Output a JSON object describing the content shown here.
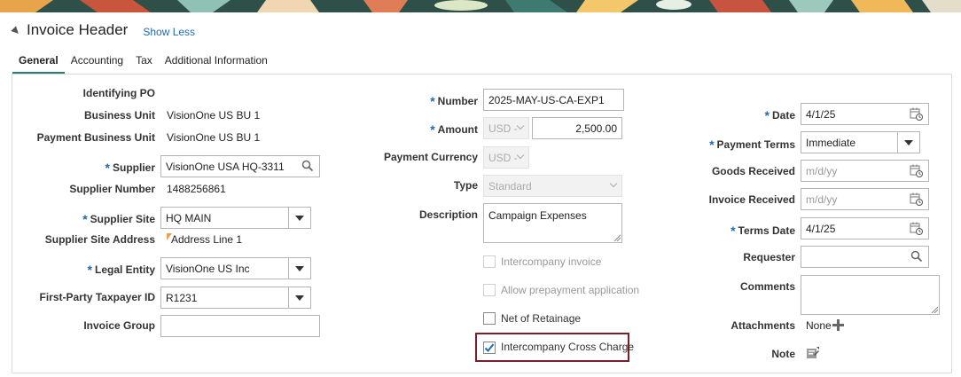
{
  "header": {
    "title": "Invoice Header",
    "show_less": "Show Less"
  },
  "tabs": [
    {
      "label": "General"
    },
    {
      "label": "Accounting"
    },
    {
      "label": "Tax"
    },
    {
      "label": "Additional Information"
    }
  ],
  "left": {
    "identifying_po_label": "Identifying PO",
    "business_unit_label": "Business Unit",
    "business_unit_value": "VisionOne US BU 1",
    "payment_bu_label": "Payment Business Unit",
    "payment_bu_value": "VisionOne US BU 1",
    "supplier_label": "Supplier",
    "supplier_value": "VisionOne USA HQ-3311",
    "supplier_number_label": "Supplier Number",
    "supplier_number_value": "1488256861",
    "supplier_site_label": "Supplier Site",
    "supplier_site_value": "HQ MAIN",
    "supplier_site_address_label": "Supplier Site Address",
    "supplier_site_address_value": "Address Line 1",
    "legal_entity_label": "Legal Entity",
    "legal_entity_value": "VisionOne US Inc",
    "taxpayer_label": "First-Party Taxpayer ID",
    "taxpayer_value": "R1231",
    "invoice_group_label": "Invoice Group",
    "invoice_group_value": ""
  },
  "middle": {
    "number_label": "Number",
    "number_value": "2025-MAY-US-CA-EXP1",
    "amount_label": "Amount",
    "amount_currency": "USD -",
    "amount_value": "2,500.00",
    "payment_currency_label": "Payment Currency",
    "payment_currency_value": "USD -",
    "type_label": "Type",
    "type_value": "Standard",
    "description_label": "Description",
    "description_value": "Campaign Expenses",
    "intercompany_invoice": "Intercompany invoice",
    "allow_prepayment": "Allow prepayment application",
    "net_of_retainage": "Net of Retainage",
    "intercompany_cross_charge": "Intercompany Cross Charge"
  },
  "right": {
    "date_label": "Date",
    "date_value": "4/1/25",
    "payment_terms_label": "Payment Terms",
    "payment_terms_value": "Immediate",
    "goods_received_label": "Goods Received",
    "goods_received_placeholder": "m/d/yy",
    "invoice_received_label": "Invoice Received",
    "invoice_received_placeholder": "m/d/yy",
    "terms_date_label": "Terms Date",
    "terms_date_value": "4/1/25",
    "requester_label": "Requester",
    "comments_label": "Comments",
    "attachments_label": "Attachments",
    "attachments_value": "None",
    "note_label": "Note"
  },
  "colors": {
    "required_marker": "#1f6ab3",
    "active_tab": "#2e7d6e",
    "highlight": "#7b1e2a",
    "checkbox_checked": "#1f6ab3"
  },
  "icons": [
    "search-icon",
    "calendar-icon",
    "plus-icon",
    "note-icon",
    "chevron-down-icon"
  ]
}
